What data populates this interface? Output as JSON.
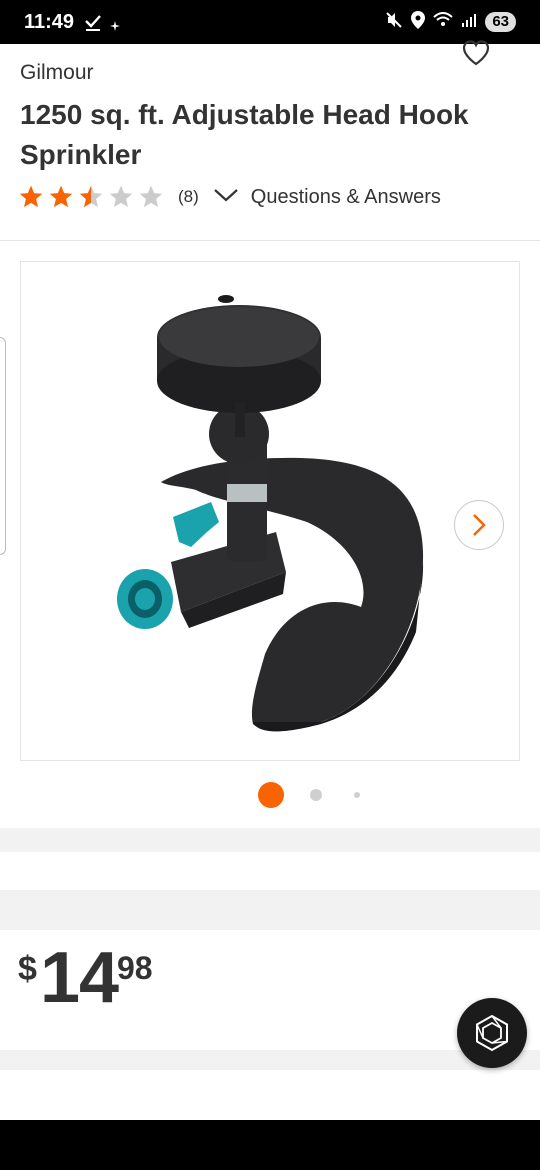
{
  "status_bar": {
    "time": "11:49",
    "battery": "63",
    "icons": [
      "check-icon",
      "sparkle-icon",
      "mute-icon",
      "location-icon",
      "wifi-icon",
      "signal-icon"
    ]
  },
  "product": {
    "brand": "Gilmour",
    "title": "1250 sq. ft. Adjustable Head Hook Sprinkler",
    "rating": 2.5,
    "rating_max": 5,
    "review_count": "(8)",
    "qa_label": "Questions & Answers"
  },
  "gallery": {
    "image_count": 3,
    "active_index": 0
  },
  "price": {
    "currency": "$",
    "dollars": "14",
    "cents": "98"
  },
  "colors": {
    "accent": "#f96302",
    "star_off": "#cccccc",
    "text": "#333333",
    "teal": "#1aa3ad"
  }
}
